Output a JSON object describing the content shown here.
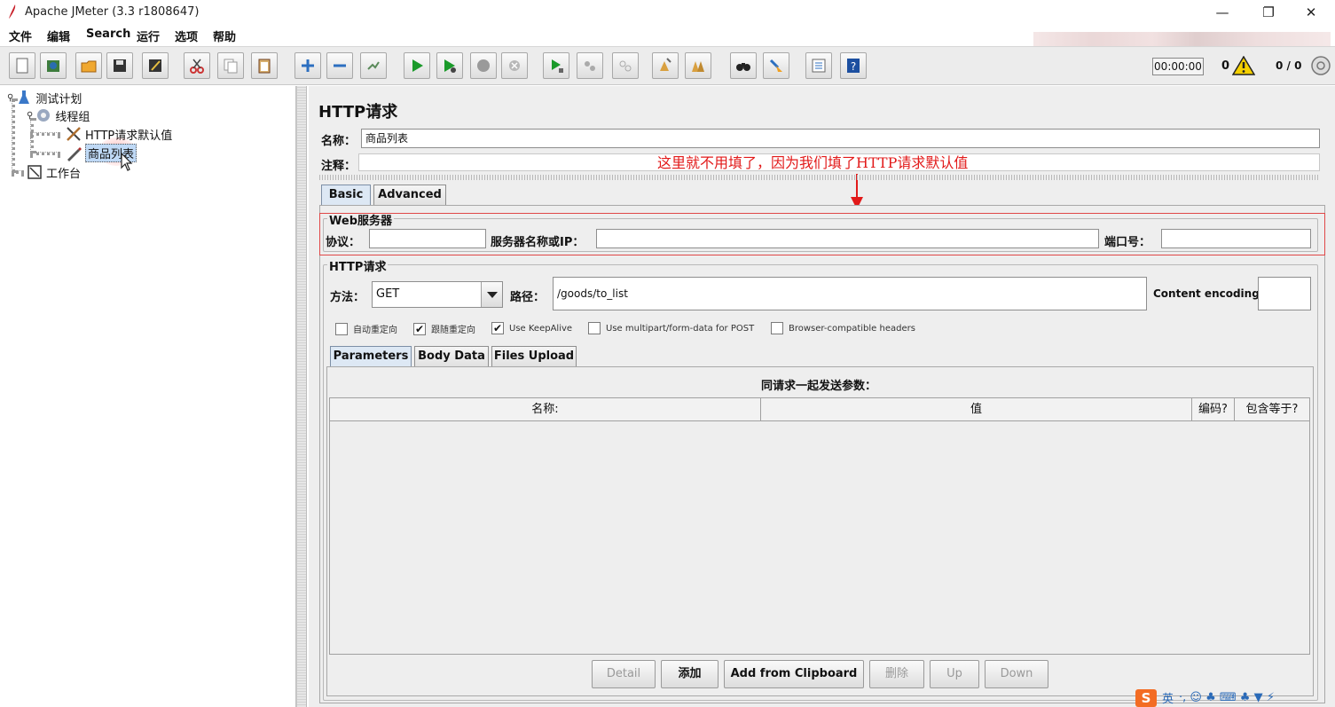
{
  "window": {
    "title": "Apache JMeter (3.3 r1808647)",
    "controls": {
      "minimize": "—",
      "maximize": "❐",
      "close": "✕"
    }
  },
  "menu": [
    "文件",
    "编辑",
    "Search",
    "运行",
    "选项",
    "帮助"
  ],
  "toolbar": {
    "icons": [
      "new-icon",
      "templates-icon",
      "open-icon",
      "save-icon",
      "save-as-icon",
      "cut-icon",
      "copy-icon",
      "paste-icon",
      "expand-icon",
      "collapse-icon",
      "toggle-icon",
      "start-icon",
      "start-no-pause-icon",
      "stop-icon",
      "shutdown-icon",
      "remote-start-icon",
      "remote-stop-icon",
      "remote-exit-icon",
      "clear-icon",
      "clear-all-icon",
      "search-icon",
      "reset-search-icon",
      "function-helper-icon",
      "help-icon"
    ],
    "timer": "00:00:00",
    "error_count": "0",
    "threads": "0 / 0"
  },
  "tree": {
    "nodes": [
      {
        "label": "测试计划",
        "icon": "test-plan-icon"
      },
      {
        "label": "线程组",
        "icon": "thread-group-icon"
      },
      {
        "label": "HTTP请求默认值",
        "icon": "config-tools-icon"
      },
      {
        "label": "商品列表",
        "icon": "sampler-pen-icon",
        "selected": true
      },
      {
        "label": "工作台",
        "icon": "workbench-icon"
      }
    ]
  },
  "main": {
    "title": "HTTP请求",
    "name_label": "名称：",
    "name_value": "商品列表",
    "comment_label": "注释：",
    "annotation": "这里就不用填了，因为我们填了HTTP请求默认值",
    "tabs": [
      "Basic",
      "Advanced"
    ],
    "web_server": {
      "title": "Web服务器",
      "protocol_label": "协议：",
      "protocol_value": "",
      "server_label": "服务器名称或IP：",
      "server_value": "",
      "port_label": "端口号：",
      "port_value": ""
    },
    "http_request": {
      "title": "HTTP请求",
      "method_label": "方法：",
      "method_value": "GET",
      "path_label": "路径：",
      "path_value": "/goods/to_list",
      "encoding_label": "Content encoding:",
      "encoding_value": ""
    },
    "checkboxes": [
      {
        "label": "自动重定向",
        "checked": false
      },
      {
        "label": "跟随重定向",
        "checked": true
      },
      {
        "label": "Use KeepAlive",
        "checked": true
      },
      {
        "label": "Use multipart/form-data for POST",
        "checked": false
      },
      {
        "label": "Browser-compatible headers",
        "checked": false
      }
    ],
    "param_tabs": [
      "Parameters",
      "Body Data",
      "Files Upload"
    ],
    "params_title": "同请求一起发送参数：",
    "columns": [
      "名称:",
      "值",
      "编码?",
      "包含等于?"
    ],
    "buttons": [
      "Detail",
      "添加",
      "Add from Clipboard",
      "删除",
      "Up",
      "Down"
    ]
  },
  "ime": {
    "logo": "S",
    "mode": "英",
    "extras": "·, ☺ ♣ ⌨ ♣ ▼ ⚡"
  }
}
